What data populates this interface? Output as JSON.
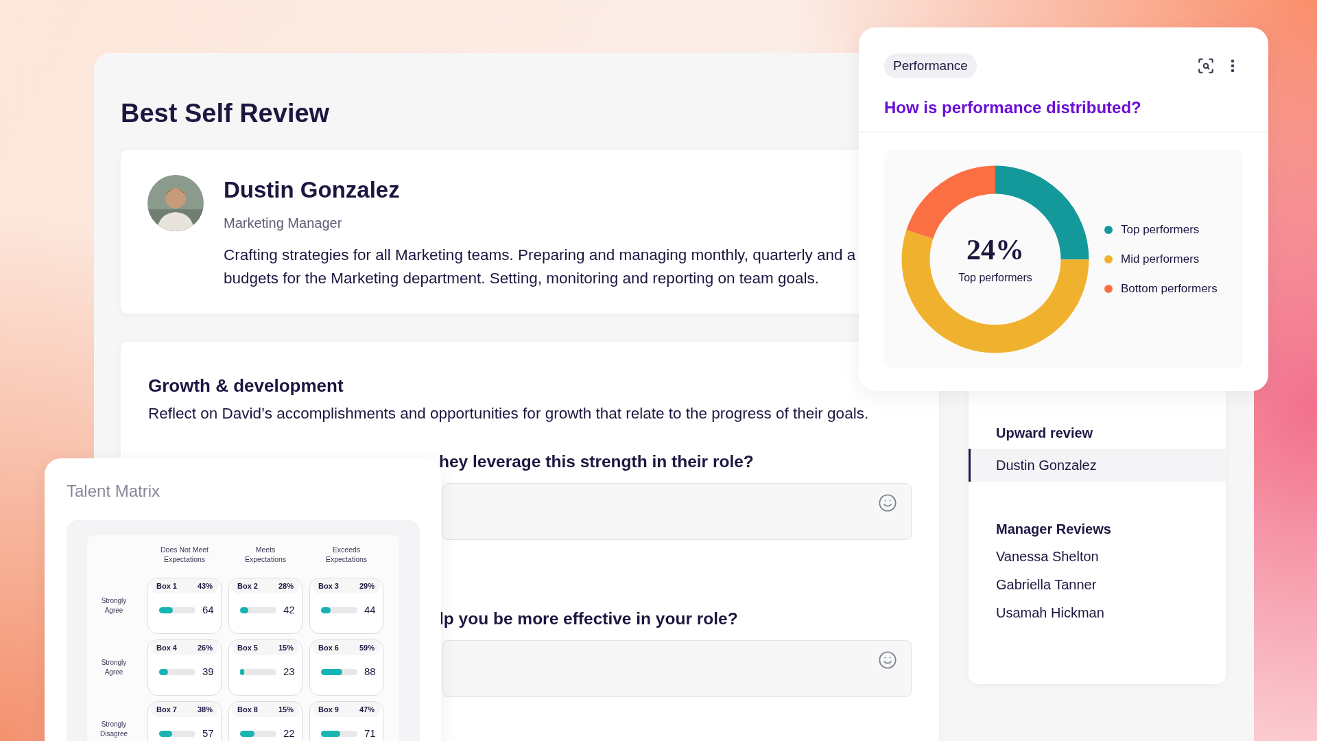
{
  "page": {
    "title": "Best Self Review"
  },
  "profile": {
    "name": "Dustin Gonzalez",
    "role": "Marketing Manager",
    "description_lines": [
      "Crafting strategies for all Marketing teams. Preparing and managing monthly, quarterly and a",
      "budgets for the Marketing department. Setting, monitoring and reporting on team goals."
    ]
  },
  "growth": {
    "title": "Growth & development",
    "description": "Reflect on David’s accomplishments and opportunities for growth that relate to the progress of their goals.",
    "questions": [
      {
        "text": "hey leverage this strength in their role?"
      },
      {
        "text": "lp you be more effective in your role?"
      }
    ]
  },
  "sidebar": {
    "sections": [
      {
        "title": "Upward review",
        "items": [
          {
            "label": "Dustin Gonzalez",
            "selected": true
          }
        ]
      },
      {
        "title": "Manager Reviews",
        "items": [
          {
            "label": "Vanessa Shelton",
            "selected": false
          },
          {
            "label": "Gabriella Tanner",
            "selected": false
          },
          {
            "label": "Usamah Hickman",
            "selected": false
          }
        ]
      }
    ]
  },
  "performance_card": {
    "tag": "Performance",
    "title": "How is performance distributed?",
    "center_value": "24%",
    "center_label": "Top performers",
    "legend": [
      {
        "label": "Top performers",
        "color": "#14999a"
      },
      {
        "label": "Mid performers",
        "color": "#f0b22e"
      },
      {
        "label": "Bottom performers",
        "color": "#fb7043"
      }
    ]
  },
  "talent_matrix": {
    "title": "Talent Matrix",
    "columns": [
      "Does Not Meet Expectations",
      "Meets Expectations",
      "Exceeds Expectations"
    ],
    "rows": [
      {
        "label": "Strongly Agree",
        "boxes": [
          {
            "name": "Box 1",
            "percent": "43%",
            "level": 0.37,
            "value": "64"
          },
          {
            "name": "Box 2",
            "percent": "28%",
            "level": 0.22,
            "value": "42"
          },
          {
            "name": "Box 3",
            "percent": "29%",
            "level": 0.27,
            "value": "44"
          }
        ]
      },
      {
        "label": "Strongly Agree",
        "boxes": [
          {
            "name": "Box 4",
            "percent": "26%",
            "level": 0.24,
            "value": "39"
          },
          {
            "name": "Box 5",
            "percent": "15%",
            "level": 0.12,
            "value": "23"
          },
          {
            "name": "Box 6",
            "percent": "59%",
            "level": 0.59,
            "value": "88"
          }
        ]
      },
      {
        "label": "Strongly Disagree",
        "boxes": [
          {
            "name": "Box 7",
            "percent": "38%",
            "level": 0.35,
            "value": "57"
          },
          {
            "name": "Box 8",
            "percent": "15%",
            "level": 0.4,
            "value": "22"
          },
          {
            "name": "Box 9",
            "percent": "47%",
            "level": 0.52,
            "value": "71"
          }
        ]
      }
    ]
  }
}
